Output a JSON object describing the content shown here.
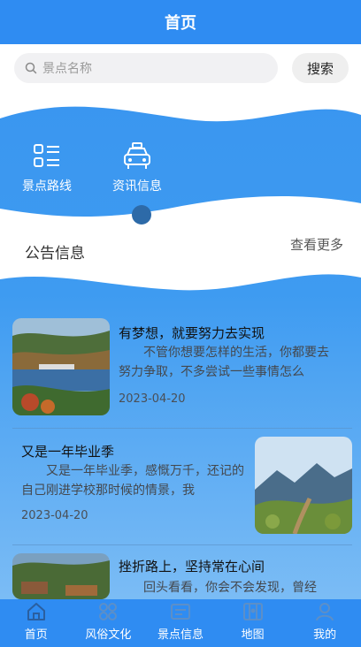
{
  "header": {
    "title": "首页"
  },
  "search": {
    "placeholder": "景点名称",
    "button": "搜索"
  },
  "categories": [
    {
      "label": "景点路线",
      "icon": "list-icon"
    },
    {
      "label": "资讯信息",
      "icon": "taxi-icon"
    }
  ],
  "notice": {
    "title": "公告信息",
    "more": "查看更多"
  },
  "news": [
    {
      "title": "有梦想，就要努力去实现",
      "body": "不管你想要怎样的生活，你都要去努力争取，不多尝试一些事情怎么",
      "date": "2023-04-20"
    },
    {
      "title": "又是一年毕业季",
      "body": "又是一年毕业季，感慨万千，还记的自己刚进学校那时候的情景，我",
      "date": "2023-04-20"
    },
    {
      "title": "挫折路上，坚持常在心间",
      "body": "回头看看，你会不会发现，曾经"
    }
  ],
  "tabbar": [
    {
      "label": "首页",
      "icon": "home-icon"
    },
    {
      "label": "风俗文化",
      "icon": "grid-icon"
    },
    {
      "label": "景点信息",
      "icon": "card-icon"
    },
    {
      "label": "地图",
      "icon": "map-icon"
    },
    {
      "label": "我的",
      "icon": "user-icon"
    }
  ],
  "colors": {
    "primary": "#2f8cf2",
    "wave": "#ffffff"
  }
}
